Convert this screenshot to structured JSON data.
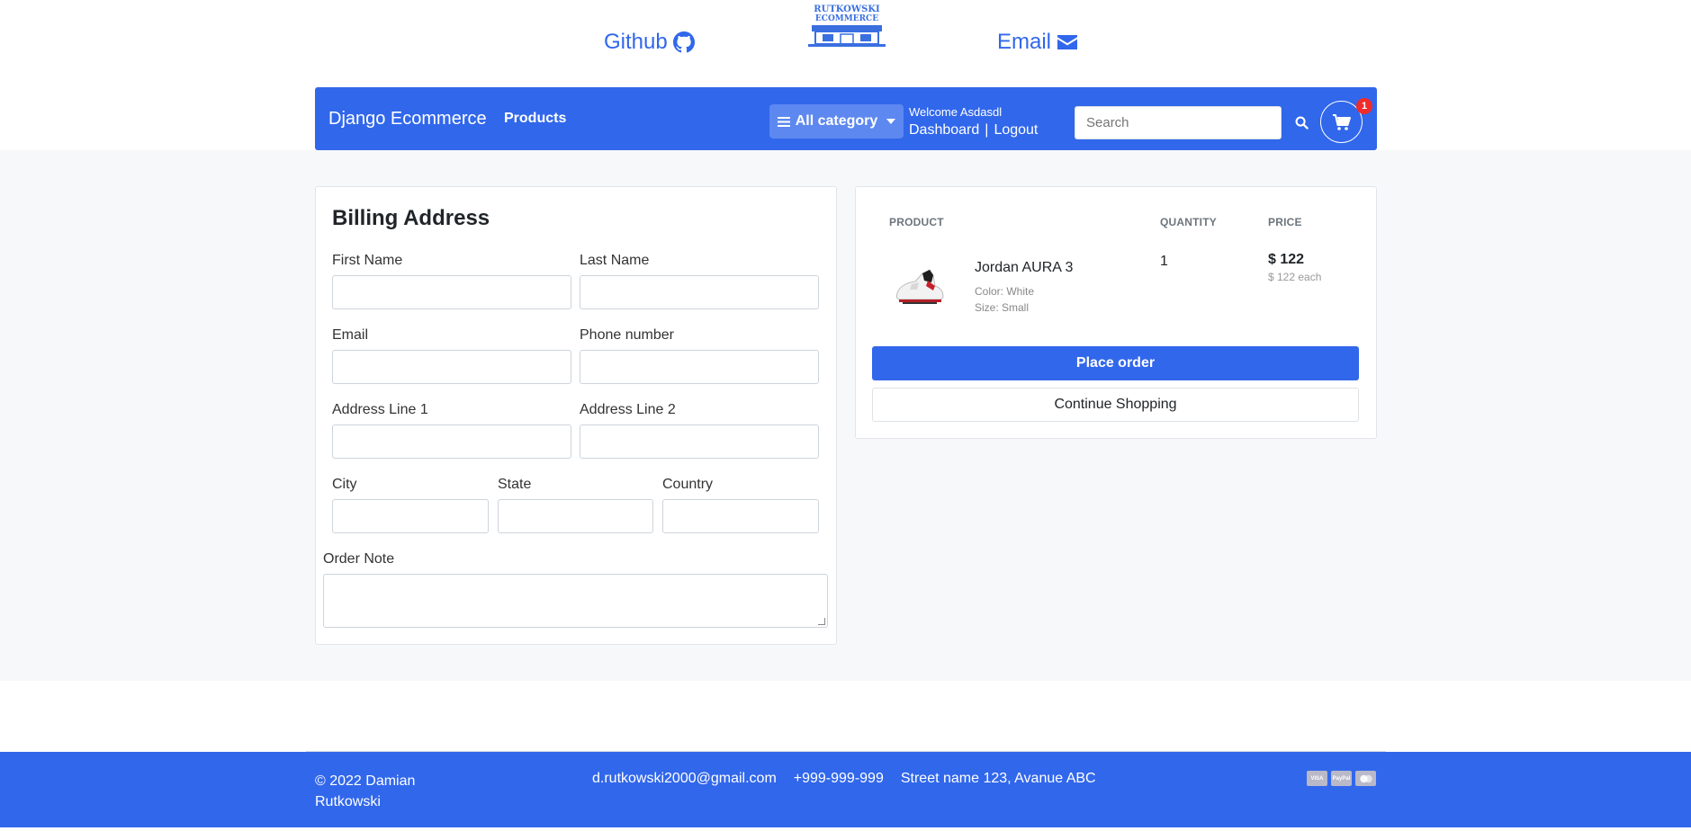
{
  "top_links": {
    "github_label": "Github",
    "email_label": "Email",
    "logo_line1": "RUTKOWSKI",
    "logo_line2": "ECOMMERCE"
  },
  "navbar": {
    "brand": "Django Ecommerce",
    "products": "Products",
    "category_button": "All category",
    "welcome": "Welcome Asdasdl",
    "dashboard": "Dashboard",
    "separator": "|",
    "logout": "Logout",
    "search_placeholder": "Search",
    "cart_count": "1"
  },
  "billing": {
    "title": "Billing Address",
    "first_name": "First Name",
    "last_name": "Last Name",
    "email": "Email",
    "phone": "Phone number",
    "address1": "Address Line 1",
    "address2": "Address Line 2",
    "city": "City",
    "state": "State",
    "country": "Country",
    "order_note": "Order Note"
  },
  "summary": {
    "headers": {
      "product": "PRODUCT",
      "quantity": "QUANTITY",
      "price": "PRICE"
    },
    "item": {
      "name": "Jordan AURA 3",
      "color": "Color: White",
      "size": "Size: Small",
      "quantity": "1",
      "price": "$ 122",
      "price_each": "$ 122 each"
    },
    "place_order": "Place order",
    "continue_shopping": "Continue Shopping"
  },
  "footer": {
    "copyright": "© 2022 Damian Rutkowski",
    "email": "d.rutkowski2000@gmail.com",
    "phone": "+999-999-999",
    "address": "Street name 123, Avanue ABC",
    "payments": [
      "VISA",
      "PayPal",
      "MC"
    ]
  },
  "colors": {
    "primary": "#3167eb",
    "badge": "#ef2b2b",
    "background": "#f7f8fa"
  }
}
